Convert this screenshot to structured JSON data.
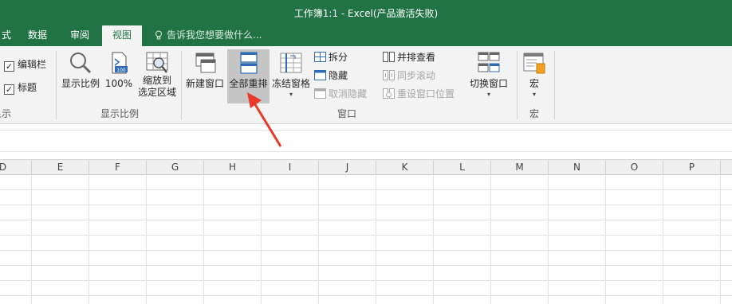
{
  "window": {
    "title": "工作簿1:1 - Excel(产品激活失败)"
  },
  "tabs": [
    {
      "label": "式",
      "active": false
    },
    {
      "label": "数据",
      "active": false
    },
    {
      "label": "审阅",
      "active": false
    },
    {
      "label": "视图",
      "active": true
    }
  ],
  "tell_me": {
    "placeholder": "告诉我您想要做什么..."
  },
  "show_group": {
    "formula_bar": {
      "label": "编辑栏",
      "checked": true
    },
    "headings": {
      "label": "标题",
      "checked": true
    },
    "group_label": "显示"
  },
  "zoom_group": {
    "zoom": "显示比例",
    "zoom100": "100%",
    "zoom_sel_line1": "缩放到",
    "zoom_sel_line2": "选定区域",
    "group_label": "显示比例"
  },
  "window_group": {
    "new_window": "新建窗口",
    "arrange_all": "全部重排",
    "freeze_panes": "冻结窗格",
    "split": "拆分",
    "hide": "隐藏",
    "unhide": "取消隐藏",
    "side_by_side": "并排查看",
    "sync_scroll": "同步滚动",
    "reset_position": "重设窗口位置",
    "switch_windows": "切换窗口",
    "group_label": "窗口"
  },
  "macro_group": {
    "macros": "宏",
    "group_label": "宏"
  },
  "columns": [
    "D",
    "E",
    "F",
    "G",
    "H",
    "I",
    "J",
    "K",
    "L",
    "M",
    "N",
    "O",
    "P"
  ],
  "colors": {
    "excel_green": "#217346",
    "ribbon_bg": "#f3f3f3",
    "arrow_red": "#e8392a",
    "selected_btn": "#c5c5c5"
  }
}
